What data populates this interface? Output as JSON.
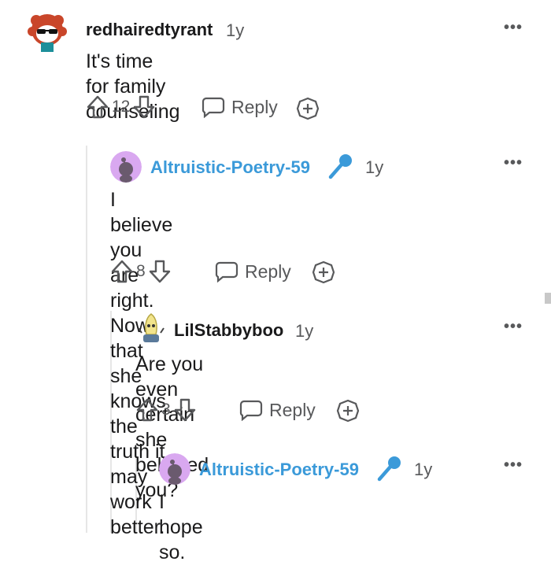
{
  "comments": [
    {
      "author": "redhairedtyrant",
      "time": "1y",
      "body_lines": [
        "It's time for family counseling"
      ],
      "votes": "12",
      "reply_label": "Reply",
      "flair_icon": null
    },
    {
      "author": "Altruistic-Poetry-59",
      "time": "1y",
      "body_lines": [
        "I believe you are right. Now that she knows",
        "the truth it may work better."
      ],
      "votes": "8",
      "reply_label": "Reply",
      "flair_icon": "microphone-icon"
    },
    {
      "author": "LilStabbyboo",
      "time": "1y",
      "body_lines": [
        "Are you even certain she believed you?"
      ],
      "votes": "3",
      "reply_label": "Reply",
      "flair_icon": null
    },
    {
      "author": "Altruistic-Poetry-59",
      "time": "1y",
      "body_lines": [
        "I hope so."
      ],
      "votes": "",
      "reply_label": "",
      "flair_icon": "microphone-icon"
    }
  ],
  "colors": {
    "author_op": "#1a1a1b",
    "author_highlight": "#3b9ad9",
    "meta": "#58595b",
    "thread_line": "#e6e6e6",
    "avatar_snoo_bg": "#d9a8f0"
  },
  "icons": {
    "upvote": "arrow-up-outline-icon",
    "downvote": "arrow-down-outline-icon",
    "reply": "speech-bubble-icon",
    "award": "plus-circle-icon",
    "more": "three-dots-icon"
  }
}
